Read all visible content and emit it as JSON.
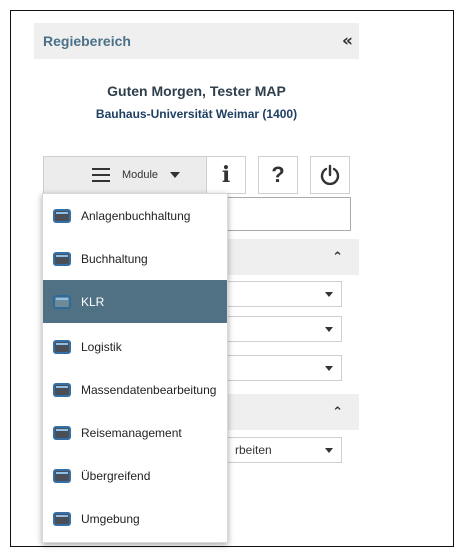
{
  "panel": {
    "title": "Regiebereich",
    "collapse_icon": "double-chevron-left-icon"
  },
  "greeting": "Guten Morgen, Tester MAP",
  "organization": "Bauhaus-Universität Weimar (1400)",
  "toolbar": {
    "module_label": "Module",
    "info_label": "i",
    "help_label": "?",
    "icons": [
      "hamburger-icon",
      "caret-down-icon",
      "info-icon",
      "help-icon",
      "power-icon"
    ]
  },
  "background_sections": {
    "select_partial_text": "rbeiten",
    "section_icon": "double-chevron-up-icon"
  },
  "module_menu": {
    "active_item": "KLR",
    "active_color": "#4f7183",
    "items": [
      {
        "label": "Anlagenbuchhaltung"
      },
      {
        "label": "Buchhaltung"
      },
      {
        "label": "KLR"
      },
      {
        "label": "Logistik"
      },
      {
        "label": "Massendatenbearbeitung"
      },
      {
        "label": "Reisemanagement"
      },
      {
        "label": "Übergreifend"
      },
      {
        "label": "Umgebung"
      }
    ]
  },
  "colors": {
    "title": "#4a7189",
    "header_bg": "#efefef",
    "org_text": "#1f3f63"
  }
}
